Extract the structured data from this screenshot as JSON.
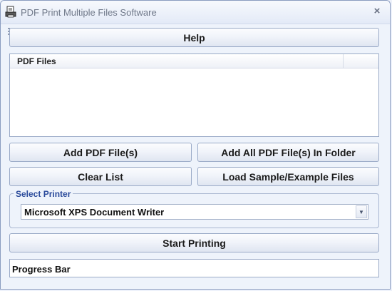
{
  "window": {
    "title": "PDF Print Multiple Files Software",
    "close_glyph": "×"
  },
  "buttons": {
    "help": "Help",
    "add_files": "Add PDF File(s)",
    "add_folder": "Add All PDF File(s) In Folder",
    "clear_list": "Clear List",
    "load_sample": "Load Sample/Example Files",
    "start_printing": "Start Printing"
  },
  "file_list": {
    "column_header": "PDF Files",
    "items": []
  },
  "printer": {
    "group_label": "Select Printer",
    "selected": "Microsoft XPS Document Writer",
    "arrow_glyph": "▼"
  },
  "progress": {
    "label": "Progress Bar",
    "value": 0
  }
}
